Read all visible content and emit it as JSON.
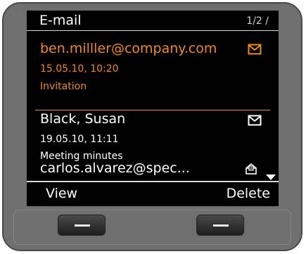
{
  "header": {
    "title": "E-mail",
    "page_indicator": "1/2 /"
  },
  "emails": [
    {
      "from": "ben.milller@company.com",
      "date": "15.05.10, 10:20",
      "subject": "Invitation",
      "state": "unread",
      "selected": true
    },
    {
      "from": "Black, Susan",
      "date": "19.05.10, 11:11",
      "subject": "Meeting minutes",
      "state": "unread",
      "selected": false
    },
    {
      "from": "carlos.alvarez@spec...",
      "state": "read",
      "selected": false
    }
  ],
  "softkeys": {
    "left": "View",
    "right": "Delete"
  },
  "colors": {
    "highlight": "#f08a1c",
    "screen_bg": "#000000",
    "device": "#6f6f6f"
  },
  "icons": {
    "unread": "envelope-icon",
    "read": "open-envelope-icon",
    "more": "scroll-down-arrow-icon"
  }
}
